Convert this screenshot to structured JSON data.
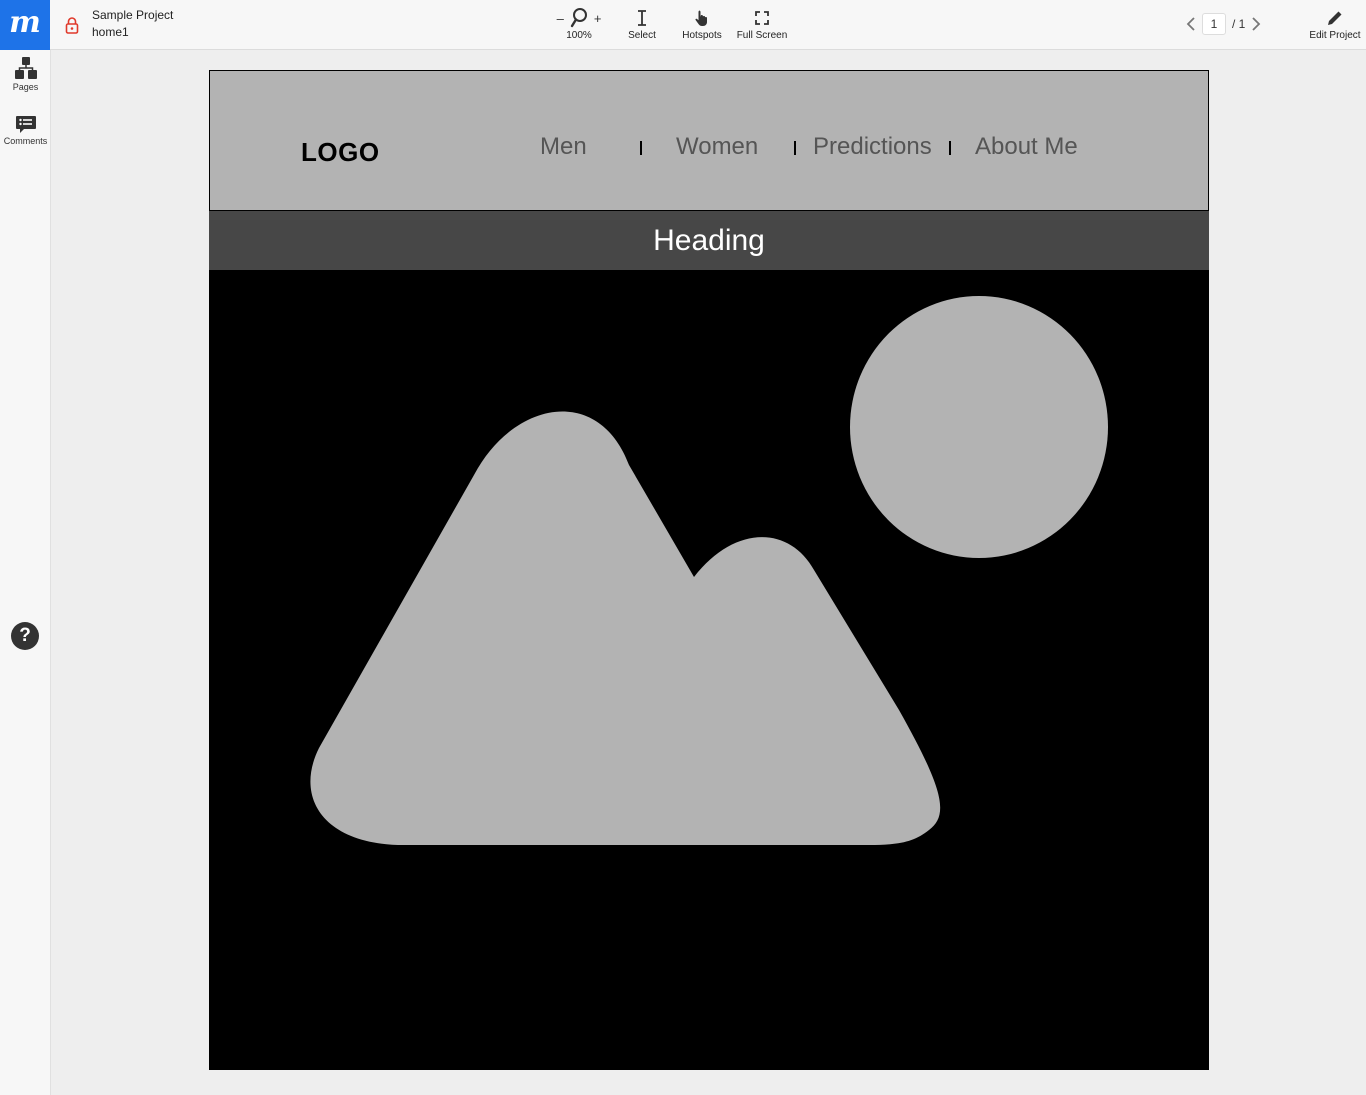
{
  "app": {
    "brand_letter": "m",
    "project_name": "Sample Project",
    "page_name": "home1"
  },
  "toolbar": {
    "zoom_minus": "–",
    "zoom_plus": "+",
    "zoom_level": "100%",
    "select_label": "Select",
    "hotspots_label": "Hotspots",
    "fullscreen_label": "Full Screen",
    "edit_label": "Edit Project"
  },
  "pager": {
    "current": "1",
    "total": "/ 1"
  },
  "sidebar": {
    "items": [
      {
        "label": "Pages",
        "icon": "pages-icon"
      },
      {
        "label": "Comments",
        "icon": "comments-icon"
      }
    ],
    "help_glyph": "?"
  },
  "mockup": {
    "logo": "LOGO",
    "nav": [
      "Men",
      "Women",
      "Predictions",
      "About Me"
    ],
    "heading": "Heading",
    "image_icon": "image-placeholder-icon"
  },
  "colors": {
    "brand": "#1e73e8",
    "navbar_bg": "#b3b3b3",
    "heading_bg": "#474747",
    "image_bg": "#000000",
    "placeholder_shape": "#b3b3b3",
    "lock": "#e0392b"
  }
}
